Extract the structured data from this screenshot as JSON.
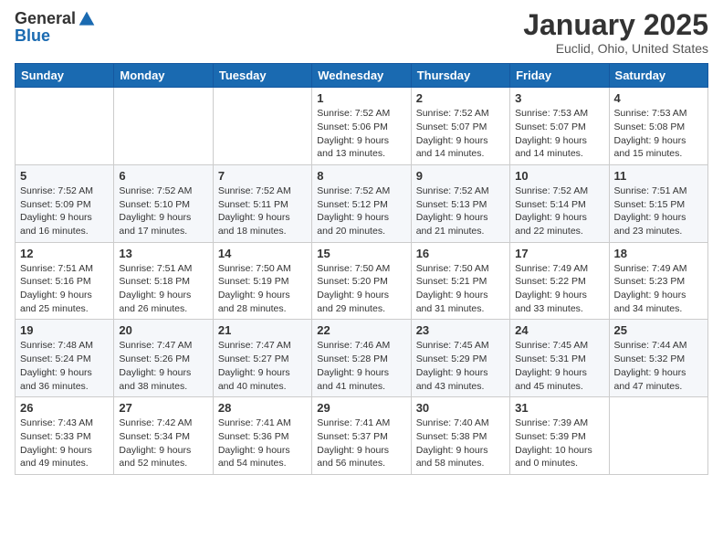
{
  "header": {
    "logo_general": "General",
    "logo_blue": "Blue",
    "month_title": "January 2025",
    "location": "Euclid, Ohio, United States"
  },
  "weekdays": [
    "Sunday",
    "Monday",
    "Tuesday",
    "Wednesday",
    "Thursday",
    "Friday",
    "Saturday"
  ],
  "weeks": [
    [
      {
        "day": "",
        "sunrise": "",
        "sunset": "",
        "daylight": ""
      },
      {
        "day": "",
        "sunrise": "",
        "sunset": "",
        "daylight": ""
      },
      {
        "day": "",
        "sunrise": "",
        "sunset": "",
        "daylight": ""
      },
      {
        "day": "1",
        "sunrise": "Sunrise: 7:52 AM",
        "sunset": "Sunset: 5:06 PM",
        "daylight": "Daylight: 9 hours and 13 minutes."
      },
      {
        "day": "2",
        "sunrise": "Sunrise: 7:52 AM",
        "sunset": "Sunset: 5:07 PM",
        "daylight": "Daylight: 9 hours and 14 minutes."
      },
      {
        "day": "3",
        "sunrise": "Sunrise: 7:53 AM",
        "sunset": "Sunset: 5:07 PM",
        "daylight": "Daylight: 9 hours and 14 minutes."
      },
      {
        "day": "4",
        "sunrise": "Sunrise: 7:53 AM",
        "sunset": "Sunset: 5:08 PM",
        "daylight": "Daylight: 9 hours and 15 minutes."
      }
    ],
    [
      {
        "day": "5",
        "sunrise": "Sunrise: 7:52 AM",
        "sunset": "Sunset: 5:09 PM",
        "daylight": "Daylight: 9 hours and 16 minutes."
      },
      {
        "day": "6",
        "sunrise": "Sunrise: 7:52 AM",
        "sunset": "Sunset: 5:10 PM",
        "daylight": "Daylight: 9 hours and 17 minutes."
      },
      {
        "day": "7",
        "sunrise": "Sunrise: 7:52 AM",
        "sunset": "Sunset: 5:11 PM",
        "daylight": "Daylight: 9 hours and 18 minutes."
      },
      {
        "day": "8",
        "sunrise": "Sunrise: 7:52 AM",
        "sunset": "Sunset: 5:12 PM",
        "daylight": "Daylight: 9 hours and 20 minutes."
      },
      {
        "day": "9",
        "sunrise": "Sunrise: 7:52 AM",
        "sunset": "Sunset: 5:13 PM",
        "daylight": "Daylight: 9 hours and 21 minutes."
      },
      {
        "day": "10",
        "sunrise": "Sunrise: 7:52 AM",
        "sunset": "Sunset: 5:14 PM",
        "daylight": "Daylight: 9 hours and 22 minutes."
      },
      {
        "day": "11",
        "sunrise": "Sunrise: 7:51 AM",
        "sunset": "Sunset: 5:15 PM",
        "daylight": "Daylight: 9 hours and 23 minutes."
      }
    ],
    [
      {
        "day": "12",
        "sunrise": "Sunrise: 7:51 AM",
        "sunset": "Sunset: 5:16 PM",
        "daylight": "Daylight: 9 hours and 25 minutes."
      },
      {
        "day": "13",
        "sunrise": "Sunrise: 7:51 AM",
        "sunset": "Sunset: 5:18 PM",
        "daylight": "Daylight: 9 hours and 26 minutes."
      },
      {
        "day": "14",
        "sunrise": "Sunrise: 7:50 AM",
        "sunset": "Sunset: 5:19 PM",
        "daylight": "Daylight: 9 hours and 28 minutes."
      },
      {
        "day": "15",
        "sunrise": "Sunrise: 7:50 AM",
        "sunset": "Sunset: 5:20 PM",
        "daylight": "Daylight: 9 hours and 29 minutes."
      },
      {
        "day": "16",
        "sunrise": "Sunrise: 7:50 AM",
        "sunset": "Sunset: 5:21 PM",
        "daylight": "Daylight: 9 hours and 31 minutes."
      },
      {
        "day": "17",
        "sunrise": "Sunrise: 7:49 AM",
        "sunset": "Sunset: 5:22 PM",
        "daylight": "Daylight: 9 hours and 33 minutes."
      },
      {
        "day": "18",
        "sunrise": "Sunrise: 7:49 AM",
        "sunset": "Sunset: 5:23 PM",
        "daylight": "Daylight: 9 hours and 34 minutes."
      }
    ],
    [
      {
        "day": "19",
        "sunrise": "Sunrise: 7:48 AM",
        "sunset": "Sunset: 5:24 PM",
        "daylight": "Daylight: 9 hours and 36 minutes."
      },
      {
        "day": "20",
        "sunrise": "Sunrise: 7:47 AM",
        "sunset": "Sunset: 5:26 PM",
        "daylight": "Daylight: 9 hours and 38 minutes."
      },
      {
        "day": "21",
        "sunrise": "Sunrise: 7:47 AM",
        "sunset": "Sunset: 5:27 PM",
        "daylight": "Daylight: 9 hours and 40 minutes."
      },
      {
        "day": "22",
        "sunrise": "Sunrise: 7:46 AM",
        "sunset": "Sunset: 5:28 PM",
        "daylight": "Daylight: 9 hours and 41 minutes."
      },
      {
        "day": "23",
        "sunrise": "Sunrise: 7:45 AM",
        "sunset": "Sunset: 5:29 PM",
        "daylight": "Daylight: 9 hours and 43 minutes."
      },
      {
        "day": "24",
        "sunrise": "Sunrise: 7:45 AM",
        "sunset": "Sunset: 5:31 PM",
        "daylight": "Daylight: 9 hours and 45 minutes."
      },
      {
        "day": "25",
        "sunrise": "Sunrise: 7:44 AM",
        "sunset": "Sunset: 5:32 PM",
        "daylight": "Daylight: 9 hours and 47 minutes."
      }
    ],
    [
      {
        "day": "26",
        "sunrise": "Sunrise: 7:43 AM",
        "sunset": "Sunset: 5:33 PM",
        "daylight": "Daylight: 9 hours and 49 minutes."
      },
      {
        "day": "27",
        "sunrise": "Sunrise: 7:42 AM",
        "sunset": "Sunset: 5:34 PM",
        "daylight": "Daylight: 9 hours and 52 minutes."
      },
      {
        "day": "28",
        "sunrise": "Sunrise: 7:41 AM",
        "sunset": "Sunset: 5:36 PM",
        "daylight": "Daylight: 9 hours and 54 minutes."
      },
      {
        "day": "29",
        "sunrise": "Sunrise: 7:41 AM",
        "sunset": "Sunset: 5:37 PM",
        "daylight": "Daylight: 9 hours and 56 minutes."
      },
      {
        "day": "30",
        "sunrise": "Sunrise: 7:40 AM",
        "sunset": "Sunset: 5:38 PM",
        "daylight": "Daylight: 9 hours and 58 minutes."
      },
      {
        "day": "31",
        "sunrise": "Sunrise: 7:39 AM",
        "sunset": "Sunset: 5:39 PM",
        "daylight": "Daylight: 10 hours and 0 minutes."
      },
      {
        "day": "",
        "sunrise": "",
        "sunset": "",
        "daylight": ""
      }
    ]
  ]
}
